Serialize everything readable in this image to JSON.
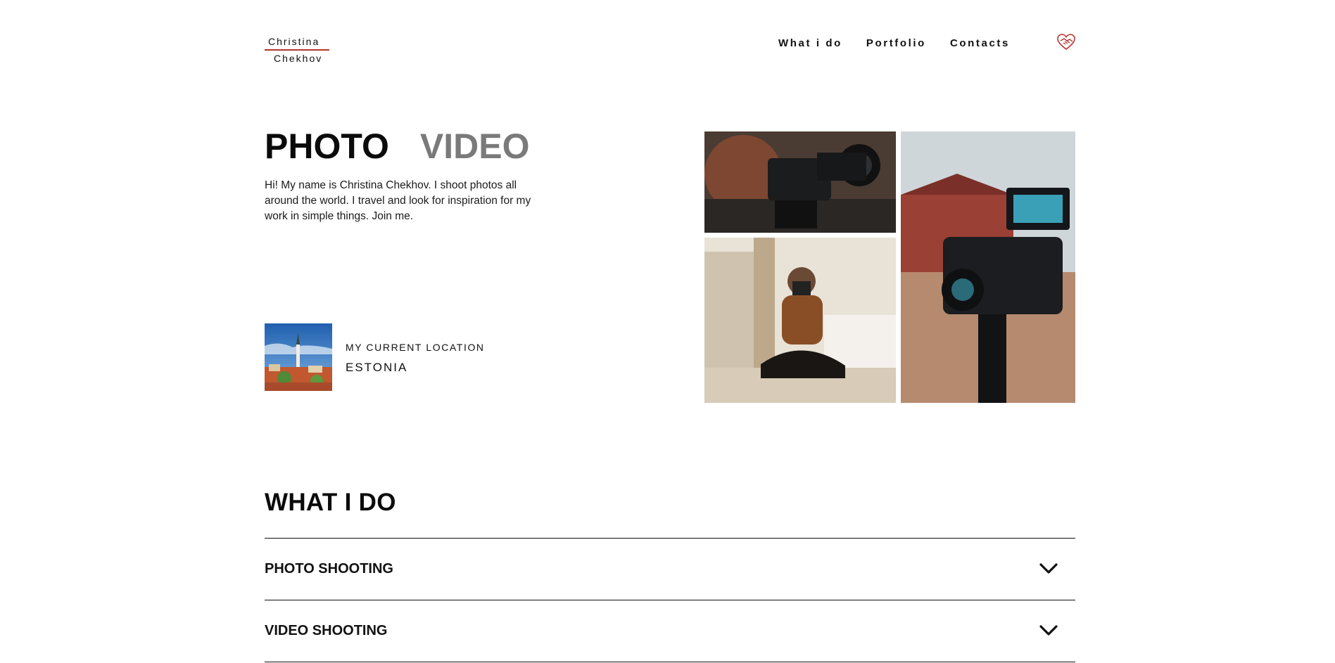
{
  "logo": {
    "line1": "Christina",
    "line2": "Chekhov"
  },
  "nav": {
    "items": [
      "What i do",
      "Portfolio",
      "Contacts"
    ]
  },
  "hero": {
    "tabs": {
      "photo": "PHOTO",
      "video": "VIDEO"
    },
    "intro": "Hi! My name is Christina Chekhov. I shoot photos all around the world. I travel and look for inspiration for my work in simple things. Join me.",
    "location": {
      "label": "MY CURRENT LOCATION",
      "value": "ESTONIA"
    }
  },
  "what_i_do": {
    "title": "WHAT I DO",
    "items": [
      "PHOTO SHOOTING",
      "VIDEO SHOOTING"
    ]
  },
  "colors": {
    "accent": "#b4332e",
    "text": "#111111",
    "muted": "#7a7a7a"
  },
  "icons": [
    "heart-handshake-icon",
    "chevron-down-icon"
  ]
}
